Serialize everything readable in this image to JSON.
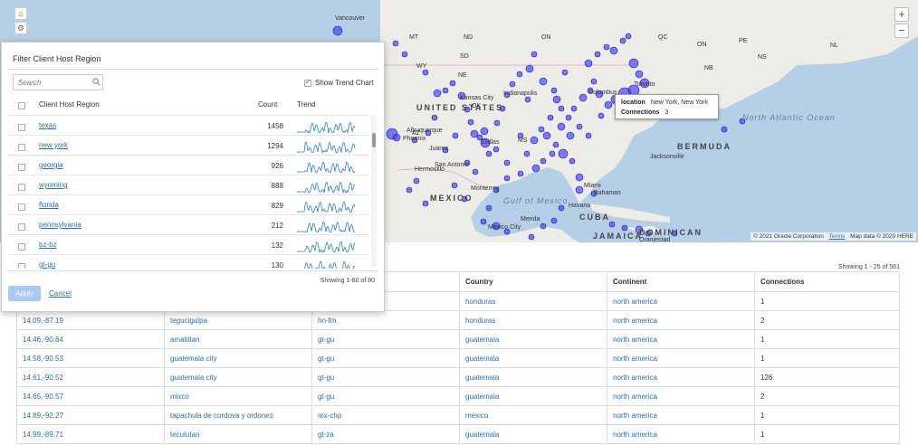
{
  "map": {
    "labels": [
      {
        "text": "Vancouver",
        "kind": "city"
      },
      {
        "text": "MT",
        "kind": "state"
      },
      {
        "text": "ND",
        "kind": "state"
      },
      {
        "text": "ON",
        "kind": "state"
      },
      {
        "text": "QC",
        "kind": "state"
      },
      {
        "text": "WY",
        "kind": "state"
      },
      {
        "text": "SD",
        "kind": "state"
      },
      {
        "text": "NE",
        "kind": "state"
      },
      {
        "text": "Kansas City",
        "kind": "city"
      },
      {
        "text": "Indianapolis",
        "kind": "city"
      },
      {
        "text": "UNITED STATES",
        "kind": "country"
      },
      {
        "text": "OK",
        "kind": "state"
      },
      {
        "text": "AZ",
        "kind": "state"
      },
      {
        "text": "Albuquerque",
        "kind": "city"
      },
      {
        "text": "Phoenix",
        "kind": "city"
      },
      {
        "text": "Dallas",
        "kind": "city"
      },
      {
        "text": "MS",
        "kind": "state"
      },
      {
        "text": "Juarez",
        "kind": "city"
      },
      {
        "text": "Hermosillo",
        "kind": "city"
      },
      {
        "text": "San Antonio",
        "kind": "city"
      },
      {
        "text": "Monterrey",
        "kind": "city"
      },
      {
        "text": "MEXICO",
        "kind": "country"
      },
      {
        "text": "Gulf of Mexico",
        "kind": "ocean"
      },
      {
        "text": "Jacksonville",
        "kind": "city"
      },
      {
        "text": "Miami",
        "kind": "city"
      },
      {
        "text": "Bahamas",
        "kind": "city"
      },
      {
        "text": "Havana",
        "kind": "city"
      },
      {
        "text": "CUBA",
        "kind": "country"
      },
      {
        "text": "Mexico City",
        "kind": "city"
      },
      {
        "text": "Merida",
        "kind": "city"
      },
      {
        "text": "JAMAICA",
        "kind": "country"
      },
      {
        "text": "DOMINICAN",
        "kind": "country"
      },
      {
        "text": "Oranjestad",
        "kind": "city"
      },
      {
        "text": "North Atlantic Ocean",
        "kind": "ocean"
      },
      {
        "text": "BERMUDA",
        "kind": "country"
      },
      {
        "text": "ON",
        "kind": "state"
      },
      {
        "text": "PE",
        "kind": "state"
      },
      {
        "text": "NB",
        "kind": "state"
      },
      {
        "text": "NS",
        "kind": "state"
      },
      {
        "text": "NL",
        "kind": "state"
      },
      {
        "text": "Columbus",
        "kind": "city"
      },
      {
        "text": "Toronto",
        "kind": "city"
      }
    ],
    "tooltip": {
      "location_label": "location",
      "location_value": "New York, New York",
      "connections_label": "Connections",
      "connections_value": "3"
    },
    "attribution": {
      "copyright": "© 2021 Oracle Corporation",
      "terms": "Terms",
      "data": "Map data © 2020 HERE"
    },
    "zoom_in": "+",
    "zoom_out": "−",
    "colors": {
      "water": "#b5cfe6",
      "land": "#eeece6",
      "point": "#3b3bff"
    }
  },
  "filter": {
    "title": "Filter Client Host Region",
    "search_placeholder": "Search",
    "show_trend_label": "Show Trend Chart",
    "show_trend_checked": true,
    "col_region": "Client Host Region",
    "col_count": "Count",
    "col_trend": "Trend",
    "rows": [
      {
        "region": "texas",
        "count": "1458"
      },
      {
        "region": "new york",
        "count": "1294"
      },
      {
        "region": "georgia",
        "count": "926"
      },
      {
        "region": "wyoming",
        "count": "888"
      },
      {
        "region": "florida",
        "count": "829"
      },
      {
        "region": "pennsylvania",
        "count": "212"
      },
      {
        "region": "bz-bz",
        "count": "132"
      },
      {
        "region": "gt-gu",
        "count": "130"
      }
    ],
    "showing": "Showing 1-80 of 80",
    "apply_label": "Apply",
    "cancel_label": "Cancel"
  },
  "table": {
    "showing": "Showing 1 - 25 of 561",
    "columns": [
      "Country",
      "Continent",
      "Connections"
    ],
    "rows": [
      {
        "coords": "",
        "city": "",
        "region": "",
        "country": "honduras",
        "continent": "north america",
        "connections": "1"
      },
      {
        "coords": "14.09,-87.19",
        "city": "tegucigalpa",
        "region": "hn-fm",
        "country": "honduras",
        "continent": "north america",
        "connections": "2"
      },
      {
        "coords": "14.46,-90.64",
        "city": "amatitlan",
        "region": "gt-gu",
        "country": "guatemala",
        "continent": "north america",
        "connections": "1"
      },
      {
        "coords": "14.58,-90.53",
        "city": "guatemala city",
        "region": "gt-gu",
        "country": "guatemala",
        "continent": "north america",
        "connections": "1"
      },
      {
        "coords": "14.61,-90.52",
        "city": "guatemala city",
        "region": "gt-gu",
        "country": "guatemala",
        "continent": "north america",
        "connections": "126"
      },
      {
        "coords": "14.65,-90.57",
        "city": "mixco",
        "region": "gt-gu",
        "country": "guatemala",
        "continent": "north america",
        "connections": "2"
      },
      {
        "coords": "14.89,-92.27",
        "city": "tapachula de cordova y ordonez",
        "region": "mx-chp",
        "country": "mexico",
        "continent": "north america",
        "connections": "1"
      },
      {
        "coords": "14.99,-89.71",
        "city": "teculutan",
        "region": "gt-za",
        "country": "guatemala",
        "continent": "north america",
        "connections": "1"
      }
    ]
  }
}
